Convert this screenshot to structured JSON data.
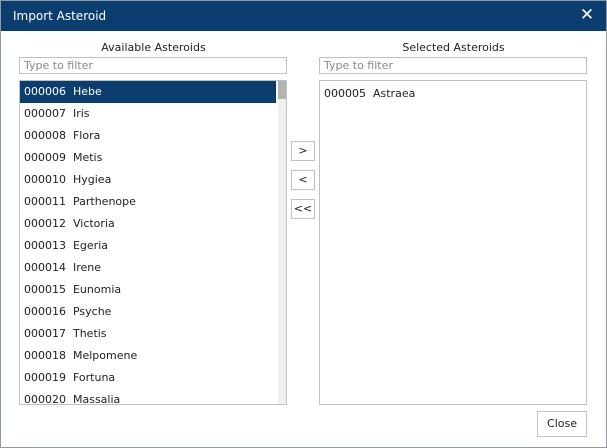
{
  "dialog": {
    "title": "Import Asteroid",
    "close_glyph": "✕"
  },
  "available": {
    "header": "Available Asteroids",
    "filter_placeholder": "Type to filter",
    "items": [
      {
        "label": "000006  Hebe",
        "selected": true
      },
      {
        "label": "000007  Iris"
      },
      {
        "label": "000008  Flora"
      },
      {
        "label": "000009  Metis"
      },
      {
        "label": "000010  Hygiea"
      },
      {
        "label": "000011  Parthenope"
      },
      {
        "label": "000012  Victoria"
      },
      {
        "label": "000013  Egeria"
      },
      {
        "label": "000014  Irene"
      },
      {
        "label": "000015  Eunomia"
      },
      {
        "label": "000016  Psyche"
      },
      {
        "label": "000017  Thetis"
      },
      {
        "label": "000018  Melpomene"
      },
      {
        "label": "000019  Fortuna"
      },
      {
        "label": "000020  Massalia"
      }
    ]
  },
  "selected": {
    "header": "Selected Asteroids",
    "filter_placeholder": "Type to filter",
    "items": [
      {
        "label": "000005  Astraea"
      }
    ]
  },
  "buttons": {
    "add": ">",
    "remove": "<",
    "remove_all": "<<",
    "close": "Close"
  },
  "colors": {
    "title_bar": "#0b3d6e",
    "selection": "#0b3d6e",
    "border": "#b9c1c9"
  }
}
